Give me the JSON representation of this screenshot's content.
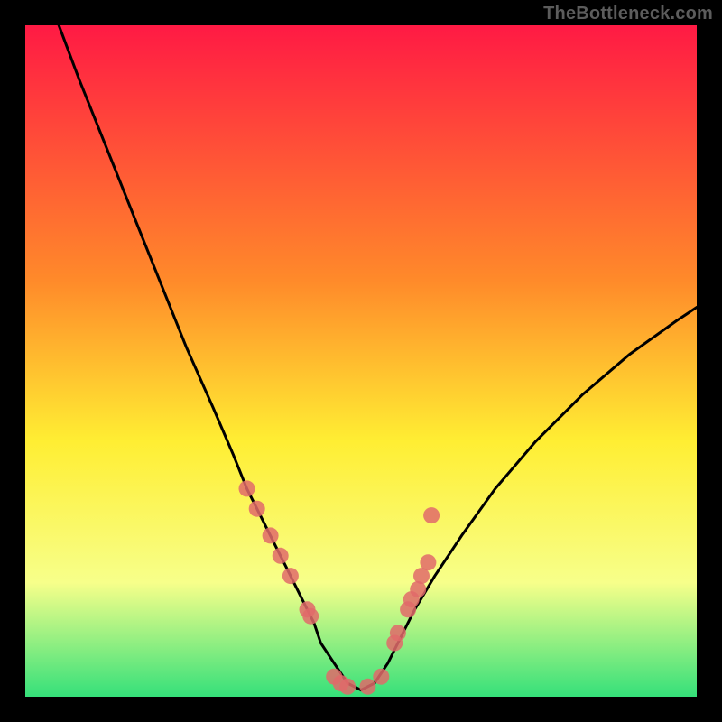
{
  "watermark": "TheBottleneck.com",
  "colors": {
    "gradient_top": "#ff1a44",
    "gradient_mid1": "#ff8a2a",
    "gradient_mid2": "#ffee33",
    "gradient_mid3": "#f7ff8a",
    "gradient_bottom": "#35e07a",
    "curve": "#000000",
    "marker": "#e06a6a",
    "marker_alpha": "0.85"
  },
  "chart_data": {
    "type": "line",
    "title": "",
    "xlabel": "",
    "ylabel": "",
    "xlim": [
      0,
      100
    ],
    "ylim": [
      0,
      100
    ],
    "grid": false,
    "annotations": [
      "TheBottleneck.com"
    ],
    "series": [
      {
        "name": "bottleneck-curve",
        "x": [
          5,
          8,
          12,
          16,
          20,
          24,
          28,
          31,
          33,
          35,
          37,
          39,
          41,
          43,
          44,
          46,
          48,
          50,
          52,
          54,
          56,
          58,
          61,
          65,
          70,
          76,
          83,
          90,
          97,
          100
        ],
        "y": [
          100,
          92,
          82,
          72,
          62,
          52,
          43,
          36,
          31,
          27,
          23,
          19,
          15,
          11,
          8,
          5,
          2,
          1,
          2,
          5,
          9,
          13,
          18,
          24,
          31,
          38,
          45,
          51,
          56,
          58
        ]
      }
    ],
    "markers": {
      "name": "highlight-points",
      "x": [
        33,
        34.5,
        36.5,
        38,
        39.5,
        42,
        42.5,
        46,
        47,
        48,
        51,
        53,
        55,
        55.5,
        57,
        57.5,
        58.5,
        59,
        60,
        60.5
      ],
      "y": [
        31,
        28,
        24,
        21,
        18,
        13,
        12,
        3,
        2,
        1.5,
        1.5,
        3,
        8,
        9.5,
        13,
        14.5,
        16,
        18,
        20,
        27
      ]
    }
  }
}
